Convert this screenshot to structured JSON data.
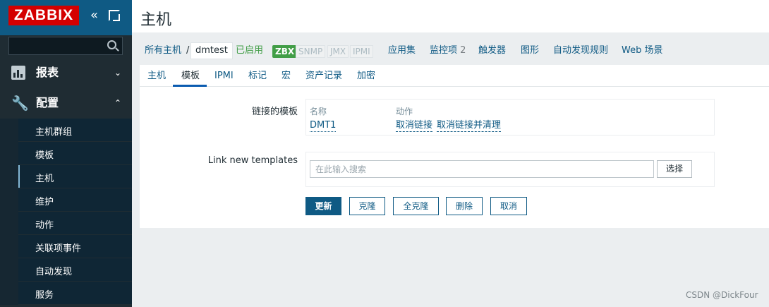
{
  "brand": {
    "logo_text": "ZABBIX"
  },
  "sidebar": {
    "search_placeholder": "",
    "sections": [
      {
        "label": "报表",
        "icon": "bar-chart-icon",
        "expanded": false
      },
      {
        "label": "配置",
        "icon": "wrench-icon",
        "expanded": true
      }
    ],
    "items": [
      {
        "label": "主机群组",
        "active": false
      },
      {
        "label": "模板",
        "active": false
      },
      {
        "label": "主机",
        "active": true
      },
      {
        "label": "维护",
        "active": false
      },
      {
        "label": "动作",
        "active": false
      },
      {
        "label": "关联项事件",
        "active": false
      },
      {
        "label": "自动发现",
        "active": false
      },
      {
        "label": "服务",
        "active": false
      }
    ]
  },
  "header": {
    "title": "主机"
  },
  "breadcrumbs": {
    "all_hosts": "所有主机",
    "separator": "/",
    "current": "dmtest",
    "status": "已启用",
    "protocols": {
      "zbx": "ZBX",
      "snmp": "SNMP",
      "jmx": "JMX",
      "ipmi": "IPMI"
    },
    "apps": "应用集",
    "items_label": "监控项",
    "items_count": "2",
    "triggers": "触发器",
    "graphs": "图形",
    "discovery": "自动发现规则",
    "web": "Web 场景"
  },
  "tabs": [
    "主机",
    "模板",
    "IPMI",
    "标记",
    "宏",
    "资产记录",
    "加密"
  ],
  "active_tab": "模板",
  "form": {
    "linked_label": "链接的模板",
    "col_name": "名称",
    "col_action": "动作",
    "template_name": "DMT1",
    "unlink": "取消链接",
    "unlink_clear": "取消链接并清理",
    "link_new_label": "Link new templates",
    "search_placeholder": "在此输入搜索",
    "select_button": "选择"
  },
  "buttons": {
    "update": "更新",
    "clone": "克隆",
    "full_clone": "全克隆",
    "delete": "删除",
    "cancel": "取消"
  },
  "watermark": "CSDN @DickFour",
  "colors": {
    "sidebar_bg": "#1f2c33",
    "brand_red": "#d40000",
    "link_blue": "#0f5a84",
    "enabled_green": "#429e47"
  }
}
